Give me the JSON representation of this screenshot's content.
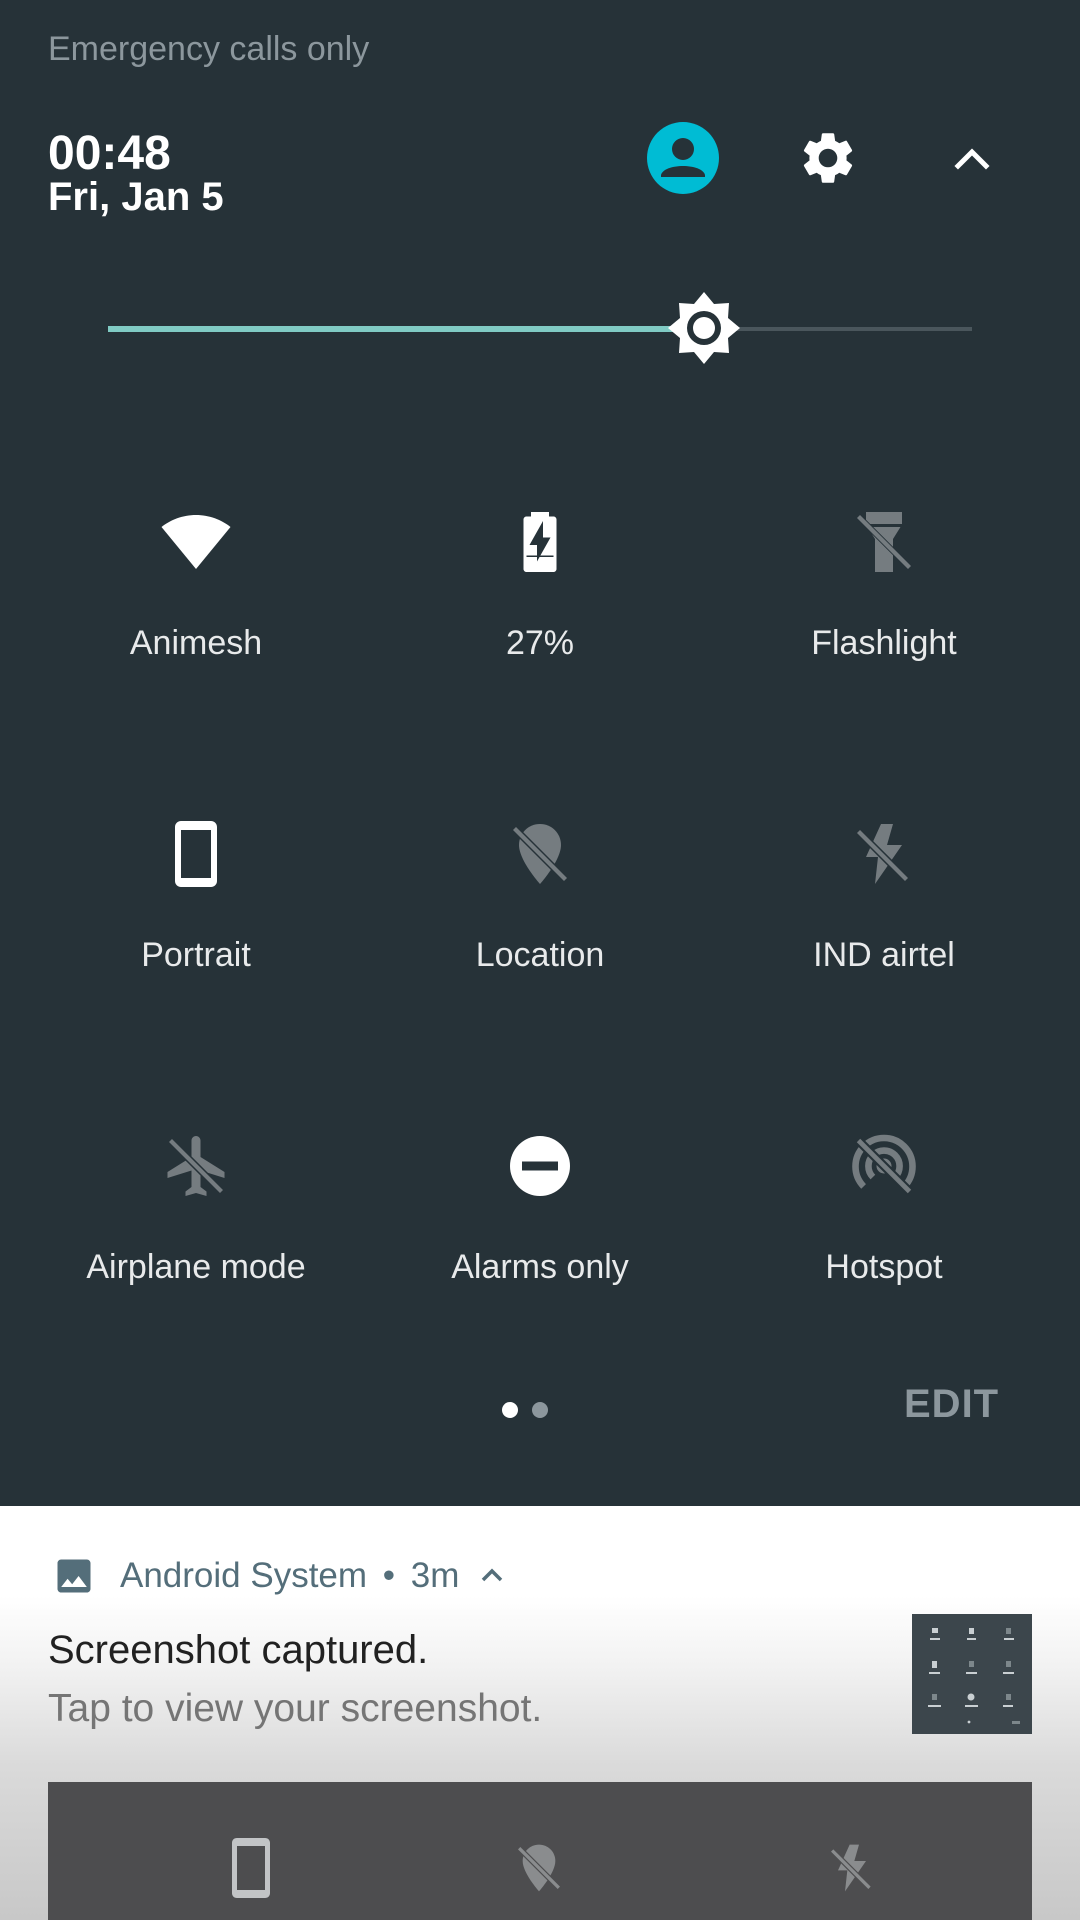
{
  "status": {
    "carrier_text": "Emergency calls only"
  },
  "header": {
    "time": "00:48",
    "date": "Fri, Jan 5",
    "icons": [
      "user-avatar-icon",
      "settings-gear-icon",
      "collapse-chevron-icon"
    ],
    "avatar_color": "#00bcd4"
  },
  "brightness": {
    "level": 0.69,
    "fill_color": "#80cbc4"
  },
  "tiles": [
    {
      "label": "Animesh",
      "icon": "wifi-icon",
      "active": true
    },
    {
      "label": "27%",
      "icon": "battery-charging-icon",
      "active": true
    },
    {
      "label": "Flashlight",
      "icon": "flashlight-off-icon",
      "active": false
    },
    {
      "label": "Portrait",
      "icon": "portrait-phone-icon",
      "active": true
    },
    {
      "label": "Location",
      "icon": "location-off-icon",
      "active": false
    },
    {
      "label": "IND airtel",
      "icon": "mobile-data-off-icon",
      "active": false
    },
    {
      "label": "Airplane mode",
      "icon": "airplane-off-icon",
      "active": false
    },
    {
      "label": "Alarms only",
      "icon": "do-not-disturb-icon",
      "active": true
    },
    {
      "label": "Hotspot",
      "icon": "hotspot-off-icon",
      "active": false
    }
  ],
  "pager": {
    "pages": 2,
    "current": 1
  },
  "edit_label": "EDIT",
  "notification": {
    "app_name": "Android System",
    "separator": "•",
    "time_ago": "3m",
    "title": "Screenshot captured.",
    "text": "Tap to view your screenshot.",
    "icon": "image-icon"
  }
}
